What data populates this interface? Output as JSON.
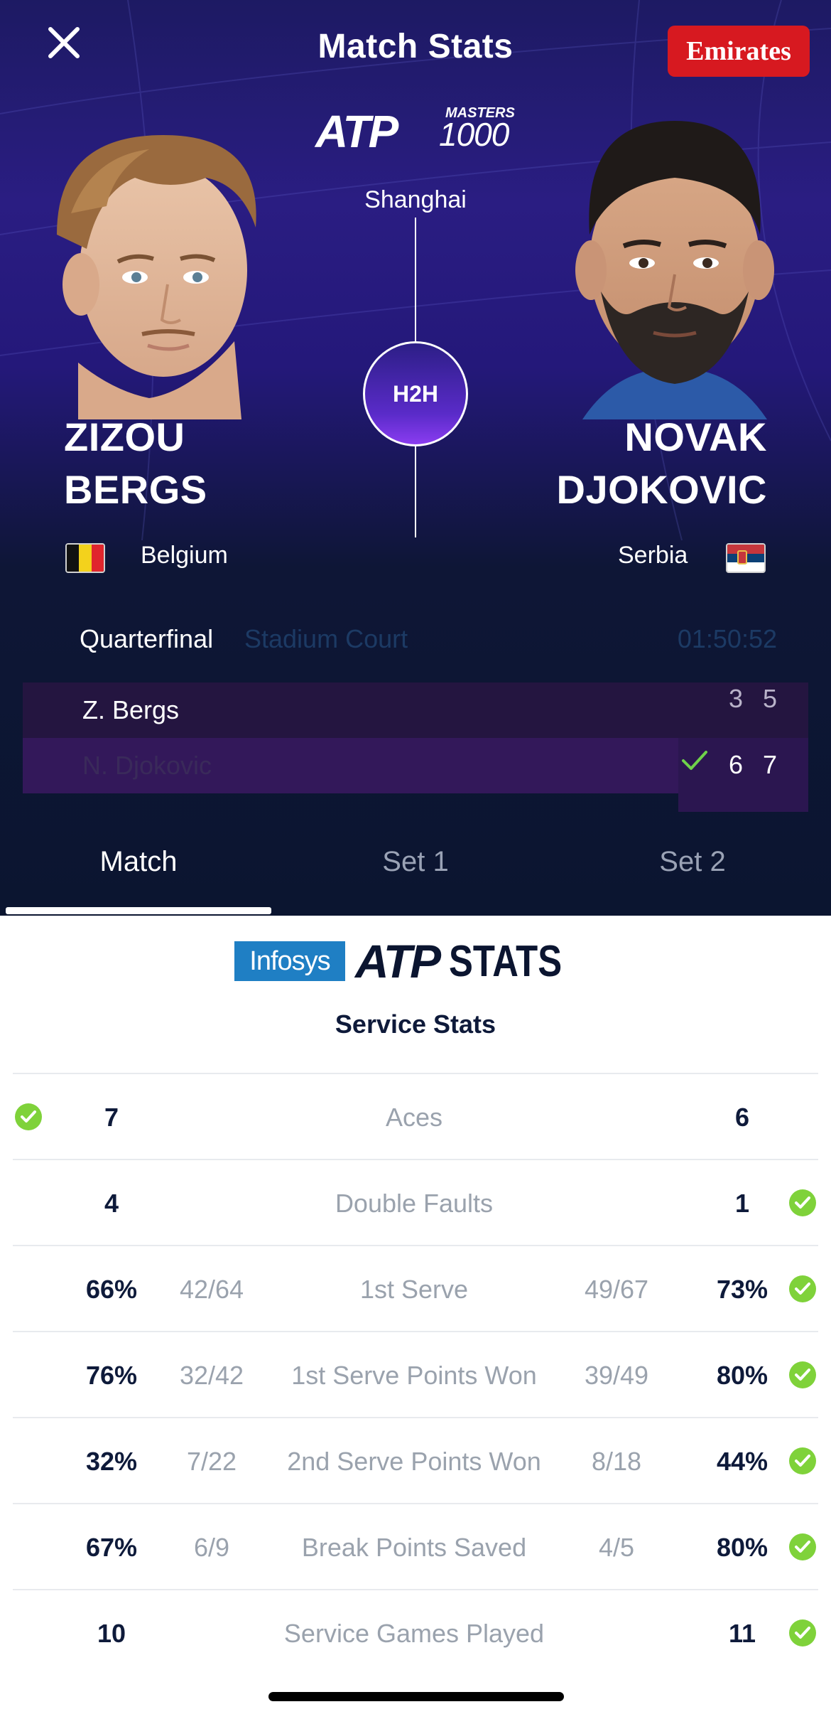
{
  "header": {
    "title": "Match Stats",
    "sponsor": "Emirates",
    "tournament_logo_word": "ATP",
    "tournament_logo_masters": "MASTERS",
    "tournament_logo_number": "1000",
    "city": "Shanghai",
    "h2h_label": "H2H"
  },
  "players": {
    "left": {
      "first": "ZIZOU",
      "last": "BERGS",
      "country": "Belgium"
    },
    "right": {
      "first": "NOVAK",
      "last": "DJOKOVIC",
      "country": "Serbia"
    }
  },
  "match_info": {
    "round": "Quarterfinal",
    "court": "Stadium Court",
    "duration": "01:50:52"
  },
  "scoreboard": {
    "rows": [
      {
        "name": "Z. Bergs",
        "sets": [
          "3",
          "5"
        ],
        "winner": false
      },
      {
        "name": "N. Djokovic",
        "sets": [
          "6",
          "7"
        ],
        "winner": true
      }
    ]
  },
  "tabs": [
    {
      "label": "Match",
      "active": true
    },
    {
      "label": "Set 1",
      "active": false
    },
    {
      "label": "Set 2",
      "active": false
    }
  ],
  "stats_header": {
    "infosys": "Infosys",
    "atp": "ATP",
    "stats": "STATS",
    "section_title": "Service Stats"
  },
  "service_stats": [
    {
      "label": "Aces",
      "left_value": "7",
      "left_fraction": "",
      "right_fraction": "",
      "right_value": "6",
      "leader": "left"
    },
    {
      "label": "Double Faults",
      "left_value": "4",
      "left_fraction": "",
      "right_fraction": "",
      "right_value": "1",
      "leader": "right"
    },
    {
      "label": "1st Serve",
      "left_value": "66%",
      "left_fraction": "42/64",
      "right_fraction": "49/67",
      "right_value": "73%",
      "leader": "right"
    },
    {
      "label": "1st Serve Points Won",
      "left_value": "76%",
      "left_fraction": "32/42",
      "right_fraction": "39/49",
      "right_value": "80%",
      "leader": "right"
    },
    {
      "label": "2nd Serve Points Won",
      "left_value": "32%",
      "left_fraction": "7/22",
      "right_fraction": "8/18",
      "right_value": "44%",
      "leader": "right"
    },
    {
      "label": "Break Points Saved",
      "left_value": "67%",
      "left_fraction": "6/9",
      "right_fraction": "4/5",
      "right_value": "80%",
      "leader": "right"
    },
    {
      "label": "Service Games Played",
      "left_value": "10",
      "left_fraction": "",
      "right_fraction": "",
      "right_value": "11",
      "leader": "right"
    }
  ],
  "colors": {
    "hero_bg": "#1d1a63",
    "accent_purple": "#5a2bc9",
    "leader_check": "#7fd23a",
    "sponsor_red": "#d71920",
    "infosys_blue": "#1f7fc4"
  }
}
